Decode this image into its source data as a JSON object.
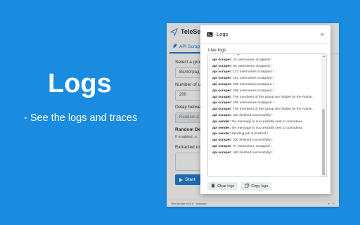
{
  "hero": {
    "title": "Logs",
    "subtitle": "- See the logs and traces"
  },
  "app": {
    "title": "TeleSen",
    "tab_label": "API Scraper",
    "fields": {
      "group_label": "Select a grou",
      "group_value": "Волгоград",
      "number_label": "Number of u",
      "number_value": "200",
      "delay_label": "Delay betwe",
      "delay_value": "Random d",
      "random_label": "Random Del",
      "random_hint": "If enabled, a",
      "extracted_label": "Extracted use"
    },
    "start_label": "Start",
    "footer_text": "TeleSender v0.0.0 · licensed"
  },
  "modal": {
    "title": "Logs",
    "close_glyph": "×",
    "live_label": "Live logs",
    "logs": [
      {
        "src": "Sessions manager:",
        "msg": "phone code received"
      },
      {
        "src": "api scraper:",
        "msg": "43 usernames scrapped !"
      },
      {
        "src": "api scraper:",
        "msg": "83 usernames scrapped !"
      },
      {
        "src": "api scraper:",
        "msg": "122 usernames scrapped !"
      },
      {
        "src": "api scraper:",
        "msg": "181 usernames scrapped !"
      },
      {
        "src": "api scraper:",
        "msg": "206 usernames scrapped !"
      },
      {
        "src": "api scraper:",
        "msg": "206 usernames scrapped !"
      },
      {
        "src": "api scraper:",
        "msg": "The members of this group are hidden by the Admin."
      },
      {
        "src": "api scraper:",
        "msg": "206 usernames scrapped !"
      },
      {
        "src": "api scraper:",
        "msg": "The members of this group are hidden by the Admin."
      },
      {
        "src": "api scraper:",
        "msg": "Job finished successfully !"
      },
      {
        "src": "api sender:",
        "msg": "the message is successfully sent to comodeau"
      },
      {
        "src": "api sender:",
        "msg": "the message is successfully sent to comodeau"
      },
      {
        "src": "api sender:",
        "msg": "Sending job is finished !"
      },
      {
        "src": "api scraper:",
        "msg": "Job finished successfully !"
      },
      {
        "src": "api scraper:",
        "msg": "47 usernames scrapped !"
      },
      {
        "src": "api scraper:",
        "msg": "Job finished successfully !"
      }
    ],
    "clear_label": "Clear logs",
    "copy_label": "Copy logs"
  }
}
